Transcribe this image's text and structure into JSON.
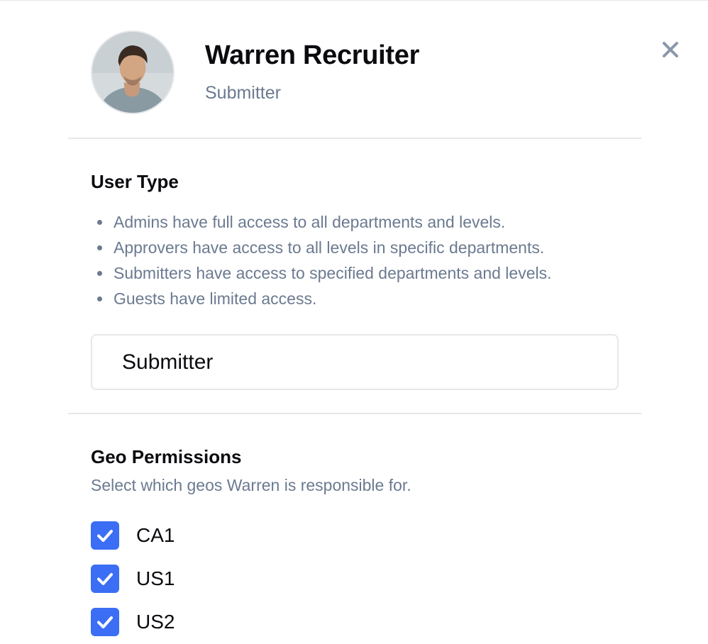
{
  "user": {
    "name": "Warren Recruiter",
    "role": "Submitter",
    "avatar_icon": "user-photo-avatar"
  },
  "close_icon": "close-icon",
  "user_type": {
    "title": "User Type",
    "descriptions": [
      "Admins have full access to all departments and levels.",
      "Approvers have access to all levels in specific departments.",
      "Submitters have access to specified departments and levels.",
      "Guests have limited access."
    ],
    "selected": "Submitter"
  },
  "geo_permissions": {
    "title": "Geo Permissions",
    "subtitle": "Select which geos Warren is responsible for.",
    "items": [
      {
        "label": "CA1",
        "checked": true
      },
      {
        "label": "US1",
        "checked": true
      },
      {
        "label": "US2",
        "checked": true
      }
    ]
  },
  "colors": {
    "accent": "#3b6ef5",
    "muted_text": "#6b7a90",
    "divider": "#e5e7eb",
    "close_icon": "#8b97aa"
  }
}
